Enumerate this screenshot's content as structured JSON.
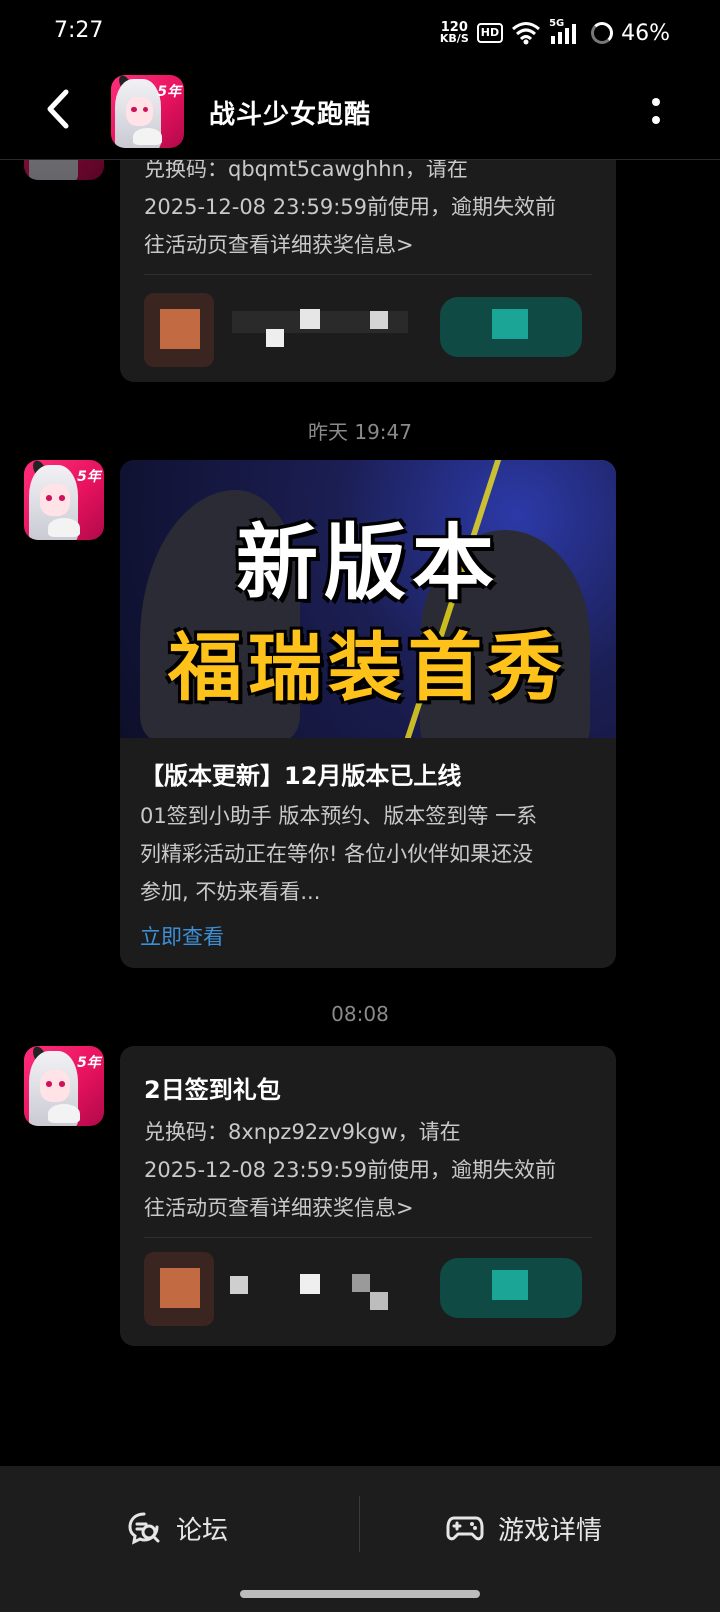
{
  "status_bar": {
    "time": "7:27",
    "net_speed_value": "120",
    "net_speed_unit": "KB/S",
    "hd": "HD",
    "network": "5G",
    "battery": "46%"
  },
  "header": {
    "title": "战斗少女跑酷",
    "avatar_badge": "5年"
  },
  "messages": [
    {
      "partial_code_line": "兑换码：qbqmt5cawghhn，请在",
      "line2": "2025-12-08 23:59:59前使用，逾期失效前",
      "line3": "往活动页查看详细获奖信息>"
    },
    {
      "timestamp": "昨天  19:47",
      "banner_line1": "新版本",
      "banner_line2": "福瑞装首秀",
      "title": "【版本更新】12月版本已上线",
      "desc_line1": "01签到小助手 版本预约、版本签到等 一系",
      "desc_line2": "列精彩活动正在等你! 各位小伙伴如果还没",
      "desc_line3": "参加, 不妨来看看...",
      "link": "立即查看"
    },
    {
      "timestamp": "08:08",
      "title": "2日签到礼包",
      "line1": "兑换码：8xnpz92zv9kgw，请在",
      "line2": "2025-12-08 23:59:59前使用，逾期失效前",
      "line3": "往活动页查看详细获奖信息>"
    }
  ],
  "bottom_bar": {
    "forum": "论坛",
    "game_details": "游戏详情"
  },
  "colors": {
    "background": "#000000",
    "card": "#1c1c1c",
    "link": "#3d8fd6",
    "accent_pink": "#e8125e",
    "banner_yellow": "#ffc21a"
  }
}
